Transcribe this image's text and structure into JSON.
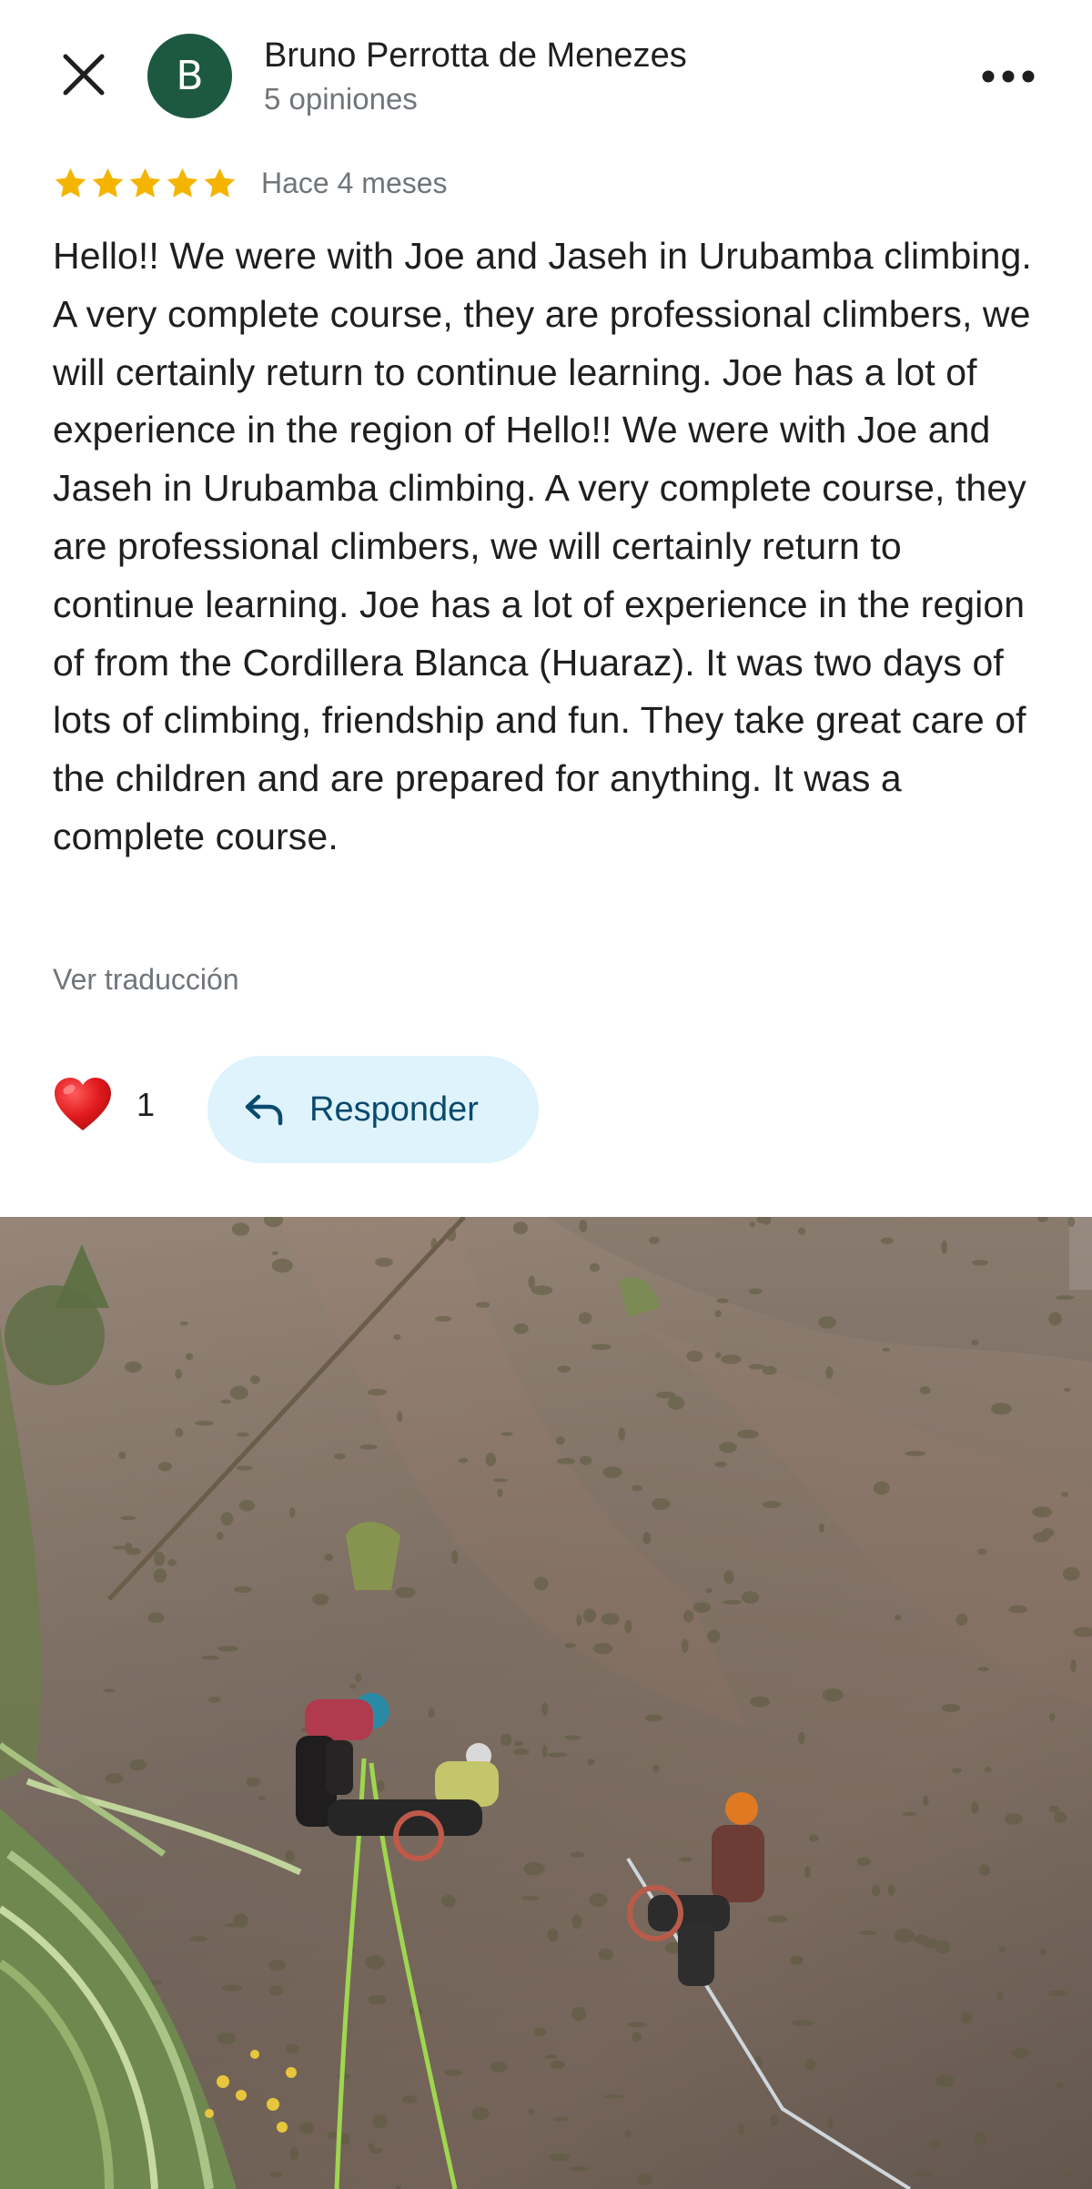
{
  "header": {
    "author_initial": "B",
    "author_name": "Bruno Perrotta de Menezes",
    "author_meta": "5 opiniones",
    "avatar_color": "#1c5940",
    "close_icon": "close-icon",
    "more_icon": "more-horizontal-icon"
  },
  "rating": {
    "stars": 5,
    "max_stars": 5,
    "star_color": "#f4b400",
    "date": "Hace 4 meses"
  },
  "review": {
    "text": "Hello!! We were with Joe and Jaseh in Urubamba climbing. A very complete course, they are professional climbers, we will certainly return to continue learning. Joe has a lot of experience in the region of Hello!! We were with Joe and Jaseh in Urubamba climbing. A very complete course, they are professional climbers, we will certainly return to continue learning. Joe has a lot of experience in the region of from the Cordillera Blanca (Huaraz). It was two days of lots of climbing, friendship and fun. They take great care of the children and are prepared for anything. It was a complete course.",
    "translate_label": "Ver traducción"
  },
  "actions": {
    "like_icon": "heart-icon",
    "like_count": "1",
    "reply_icon": "reply-icon",
    "reply_label": "Responder",
    "reply_bg": "#def3fc"
  },
  "photo": {
    "subject": "rock-climbing-photo"
  }
}
